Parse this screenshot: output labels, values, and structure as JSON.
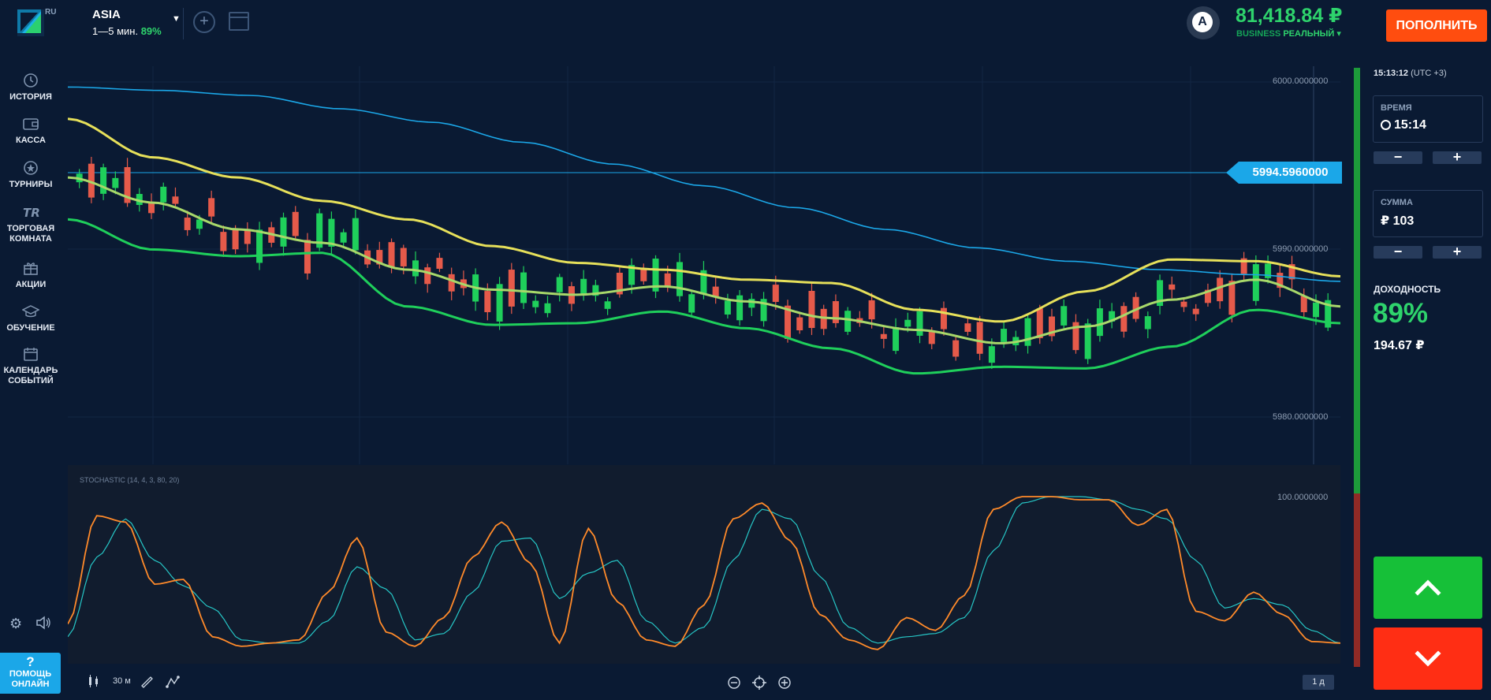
{
  "header": {
    "logo_badge": "RU",
    "asset_name": "ASIA",
    "asset_period": "1—5 мин.",
    "asset_payout": "89%",
    "avatar_letter": "A",
    "balance": "81,418.84 ₽",
    "account_level": "BUSINESS",
    "account_mode": "РЕАЛЬНЫЙ ▾",
    "deposit_label": "ПОПОЛНИТЬ"
  },
  "sidebar": {
    "items": [
      {
        "label": "ИСТОРИЯ",
        "icon": "history-icon"
      },
      {
        "label": "КАССА",
        "icon": "wallet-icon"
      },
      {
        "label": "ТУРНИРЫ",
        "icon": "trophy-icon"
      },
      {
        "label": "ТОРГОВАЯ КОМНАТА",
        "icon": "trading-room-icon"
      },
      {
        "label": "АКЦИИ",
        "icon": "gift-icon"
      },
      {
        "label": "ОБУЧЕНИЕ",
        "icon": "education-icon"
      },
      {
        "label": "КАЛЕНДАРЬ СОБЫТИЙ",
        "icon": "calendar-icon"
      }
    ],
    "help_label": "ПОМОЩЬ ОНЛАЙН"
  },
  "chart": {
    "price_labels": [
      "6000.0000000",
      "5990.0000000",
      "5980.0000000"
    ],
    "current_price": "5994.5960000",
    "indicator_label": "STOCHASTIC (14, 4, 3, 80, 20)",
    "stoch_top_label": "100.0000000"
  },
  "chart_data": {
    "type": "candlestick",
    "y_axis_ticks": [
      6000,
      5990,
      5980
    ],
    "current_price": 5994.596,
    "indicator": "STOCHASTIC (14, 4, 3, 80, 20)",
    "indicator_range": [
      0,
      100
    ],
    "overlay_colors": {
      "ma_long": "#1ba7e8",
      "upper_band": "#e6e05a",
      "middle_band": "#a8d86a",
      "lower_band": "#1fcf5b"
    },
    "candle_colors": {
      "up": "#1fcf5b",
      "down": "#e55a4a"
    },
    "stoch_colors": {
      "k": "#ff8a2a",
      "d": "#26c6c6"
    }
  },
  "right_panel": {
    "clock": "15:13:12",
    "timezone": "(UTC +3)",
    "time_label": "ВРЕМЯ",
    "time_value": "15:14",
    "amount_label": "СУММА",
    "amount_value": "₽ 103",
    "minus": "−",
    "plus": "+",
    "profit_label": "ДОХОДНОСТЬ",
    "profit_percent": "89%",
    "profit_amount": "194.67 ₽"
  },
  "bottom": {
    "timeframe": "30 м",
    "period": "1 д"
  }
}
